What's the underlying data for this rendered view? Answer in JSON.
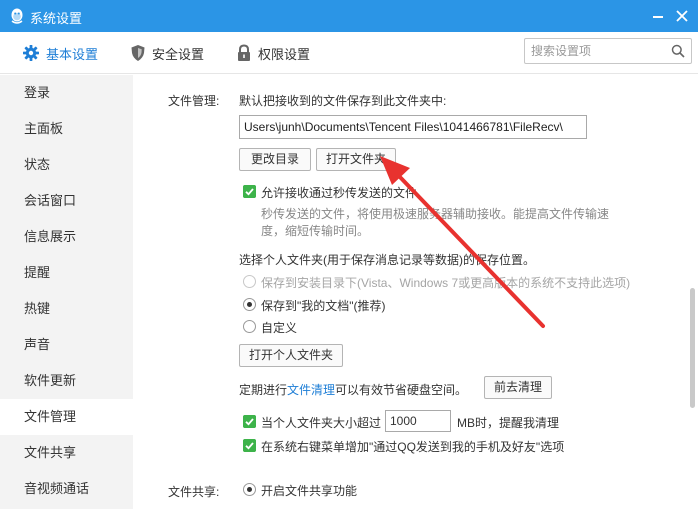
{
  "window": {
    "title": "系统设置"
  },
  "tabs": [
    {
      "label": "基本设置",
      "active": true,
      "icon": "gear-icon"
    },
    {
      "label": "安全设置",
      "active": false,
      "icon": "shield-icon"
    },
    {
      "label": "权限设置",
      "active": false,
      "icon": "lock-icon"
    }
  ],
  "search": {
    "placeholder": "搜索设置项"
  },
  "sidebar": {
    "items": [
      {
        "label": "登录"
      },
      {
        "label": "主面板"
      },
      {
        "label": "状态"
      },
      {
        "label": "会话窗口"
      },
      {
        "label": "信息展示"
      },
      {
        "label": "提醒"
      },
      {
        "label": "热键"
      },
      {
        "label": "声音"
      },
      {
        "label": "软件更新"
      },
      {
        "label": "文件管理",
        "active": true
      },
      {
        "label": "文件共享"
      },
      {
        "label": "音视频通话"
      }
    ]
  },
  "file_management": {
    "section_label": "文件管理:",
    "save_heading": "默认把接收到的文件保存到此文件夹中:",
    "path_value": "Users\\junh\\Documents\\Tencent Files\\1041466781\\FileRecv\\",
    "change_dir_button": "更改目录",
    "open_folder_button": "打开文件夹",
    "allow_flash_label": "允许接收通过秒传发送的文件",
    "allow_flash_desc_1": "秒传发送的文件，将使用极速服务器辅助接收。能提高文件传输速",
    "allow_flash_desc_2": "度，缩短传输时间。",
    "personal_folder_heading": "选择个人文件夹(用于保存消息记录等数据)的保存位置。",
    "radio_install_dir": "保存到安装目录下(Vista、Windows 7或更高版本的系统不支持此选项)",
    "radio_my_docs": "保存到\"我的文档\"(推荐)",
    "radio_custom": "自定义",
    "open_personal_folder_button": "打开个人文件夹",
    "cleanup_prefix": "定期进行",
    "cleanup_link": "文件清理",
    "cleanup_suffix": "可以有效节省硬盘空间。",
    "goto_cleanup_button": "前去清理",
    "size_limit_prefix": "当个人文件夹大小超过",
    "size_limit_value": "1000",
    "size_limit_suffix": "MB时，提醒我清理",
    "context_menu_label": "在系统右键菜单增加\"通过QQ发送到我的手机及好友\"选项"
  },
  "file_sharing": {
    "section_label": "文件共享:",
    "enable_label": "开启文件共享功能"
  },
  "colors": {
    "titlebar": "#2b95e6",
    "accent": "#1e7ed6",
    "checkbox": "#3db34a",
    "annotation_arrow": "#e8322f"
  }
}
